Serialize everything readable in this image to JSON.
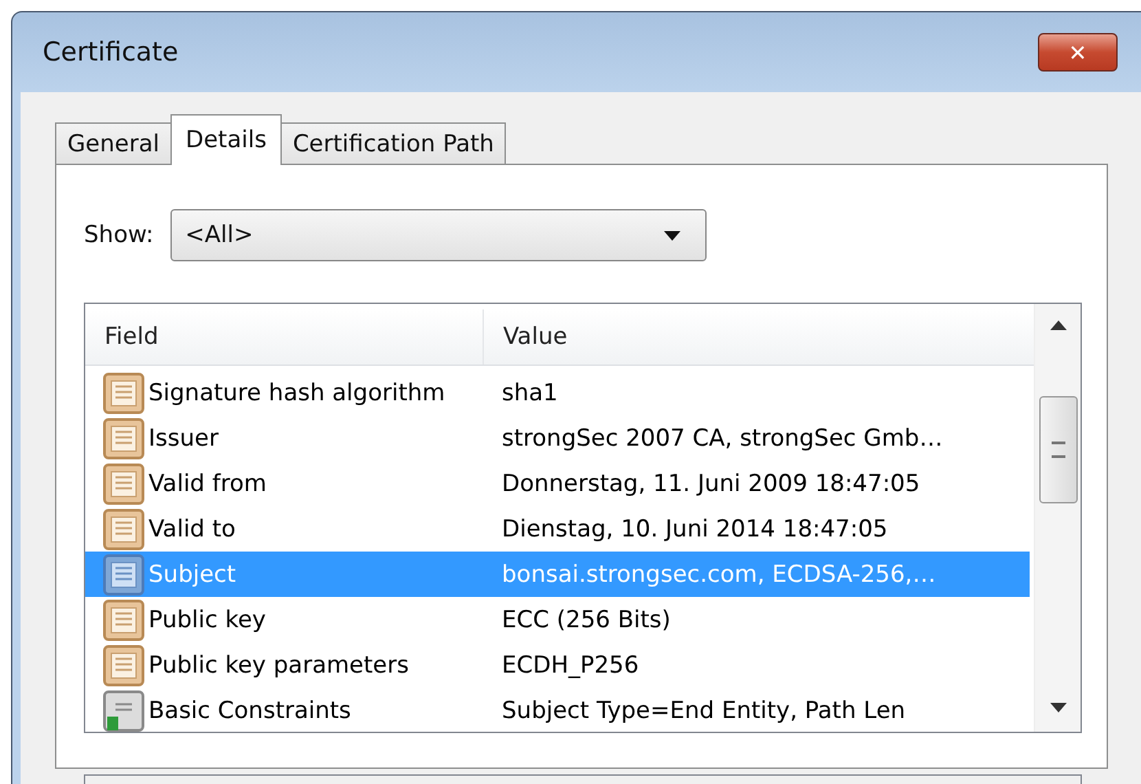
{
  "window": {
    "title": "Certificate",
    "close": "✕"
  },
  "tabs": [
    {
      "label": "General",
      "selected": false
    },
    {
      "label": "Details",
      "selected": true
    },
    {
      "label": "Certification Path",
      "selected": false
    }
  ],
  "show": {
    "label": "Show:",
    "value": "<All>"
  },
  "table": {
    "columns": [
      "Field",
      "Value"
    ],
    "rows": [
      {
        "kind": "field",
        "field": "Signature hash algorithm",
        "value": "sha1",
        "selected": false
      },
      {
        "kind": "field",
        "field": "Issuer",
        "value": "strongSec 2007 CA, strongSec Gmb…",
        "selected": false
      },
      {
        "kind": "field",
        "field": "Valid from",
        "value": "Donnerstag, 11. Juni 2009 18:47:05",
        "selected": false
      },
      {
        "kind": "field",
        "field": "Valid to",
        "value": "Dienstag, 10. Juni 2014 18:47:05",
        "selected": false
      },
      {
        "kind": "field",
        "field": "Subject",
        "value": "bonsai.strongsec.com, ECDSA-256,…",
        "selected": true
      },
      {
        "kind": "field",
        "field": "Public key",
        "value": "ECC (256 Bits)",
        "selected": false
      },
      {
        "kind": "field",
        "field": "Public key parameters",
        "value": "ECDH_P256",
        "selected": false
      },
      {
        "kind": "extension",
        "field": "Basic Constraints",
        "value": "Subject Type=End Entity, Path Len",
        "selected": false
      }
    ]
  }
}
